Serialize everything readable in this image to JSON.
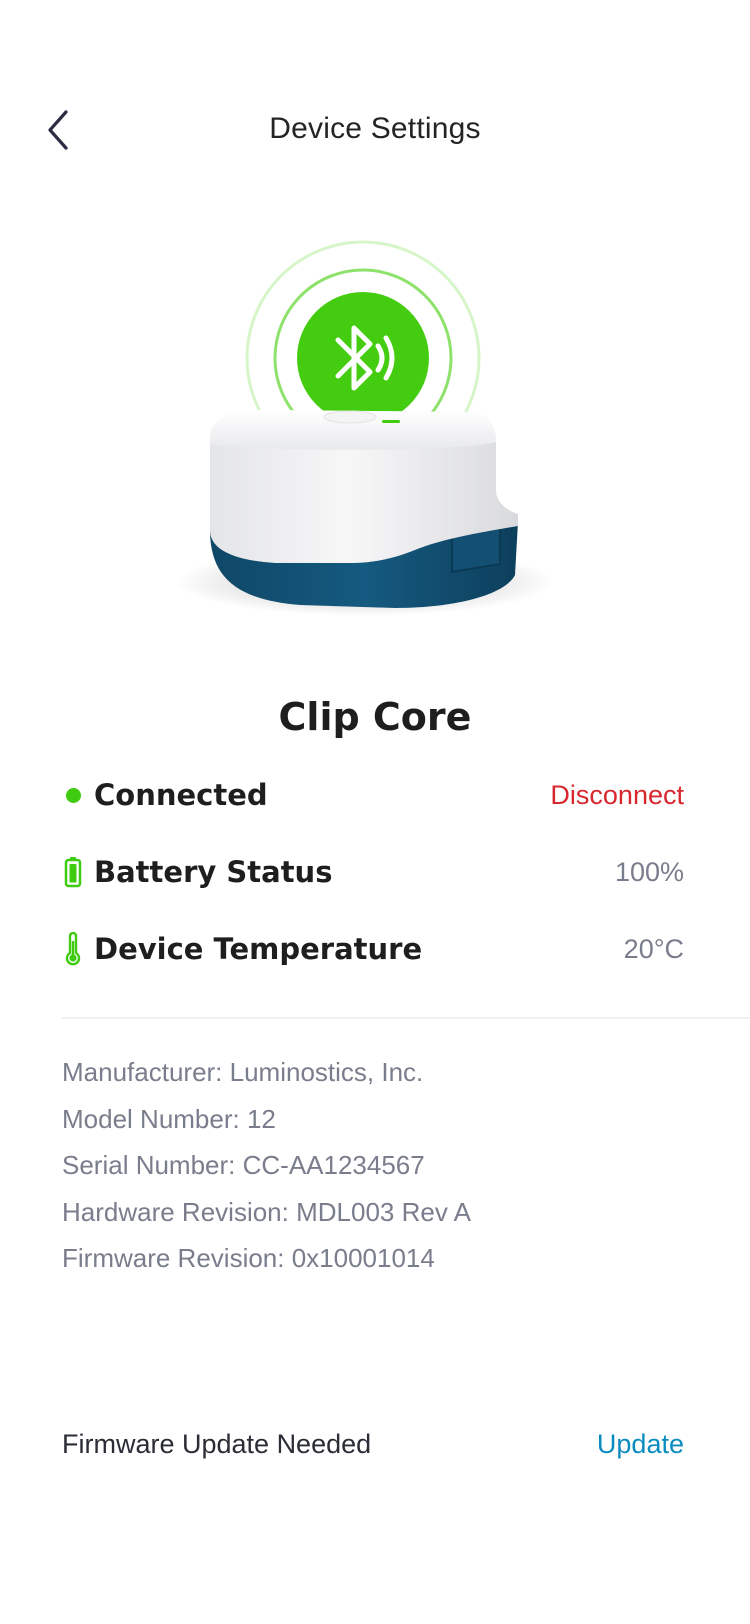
{
  "header": {
    "title": "Device Settings",
    "back_icon": "chevron-left-icon"
  },
  "device": {
    "name": "Clip Core",
    "image": "bluetooth-hub-device",
    "bluetooth_icon": "bluetooth-audio-icon",
    "accent_color": "#3ecb10"
  },
  "status": {
    "connection": {
      "label": "Connected",
      "action": "Disconnect",
      "icon": "status-dot-icon",
      "action_color": "#d7282f"
    },
    "battery": {
      "label": "Battery Status",
      "value": "100%",
      "icon": "battery-icon"
    },
    "temperature": {
      "label": "Device Temperature",
      "value": "20°C",
      "icon": "thermometer-icon"
    }
  },
  "info": {
    "manufacturer": "Manufacturer: Luminostics, Inc.",
    "model": "Model Number: 12",
    "serial": "Serial Number: CC-AA1234567",
    "hardware": "Hardware Revision: MDL003 Rev A",
    "firmware": "Firmware Revision: 0x10001014"
  },
  "firmware_update": {
    "label": "Firmware Update Needed",
    "action": "Update",
    "action_color": "#0a8cc0"
  }
}
